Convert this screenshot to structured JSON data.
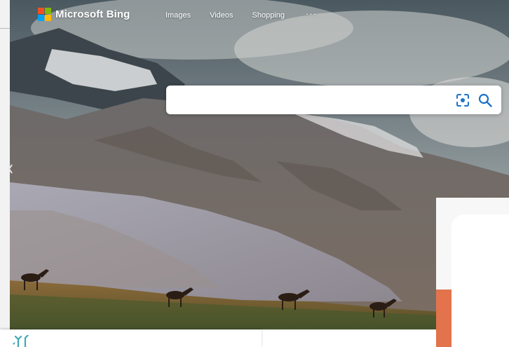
{
  "header": {
    "brand": "Microsoft Bing",
    "logo_colors": [
      "#f25022",
      "#7fba00",
      "#00a4ef",
      "#ffb900"
    ],
    "nav": {
      "images": "Images",
      "videos": "Videos",
      "shopping": "Shopping",
      "more": "···"
    }
  },
  "search": {
    "value": "",
    "placeholder": "",
    "visual_search_icon": "visual-search-icon",
    "search_icon": "search-icon",
    "accent": "#1a73c9"
  },
  "background": {
    "scene": "mountain-landscape"
  },
  "overlay_window": {
    "accent": "#e2734d"
  },
  "bottom_window": {
    "logo_icon": "teal-sparkle-logo-icon",
    "accent": "#3fa8b5"
  }
}
